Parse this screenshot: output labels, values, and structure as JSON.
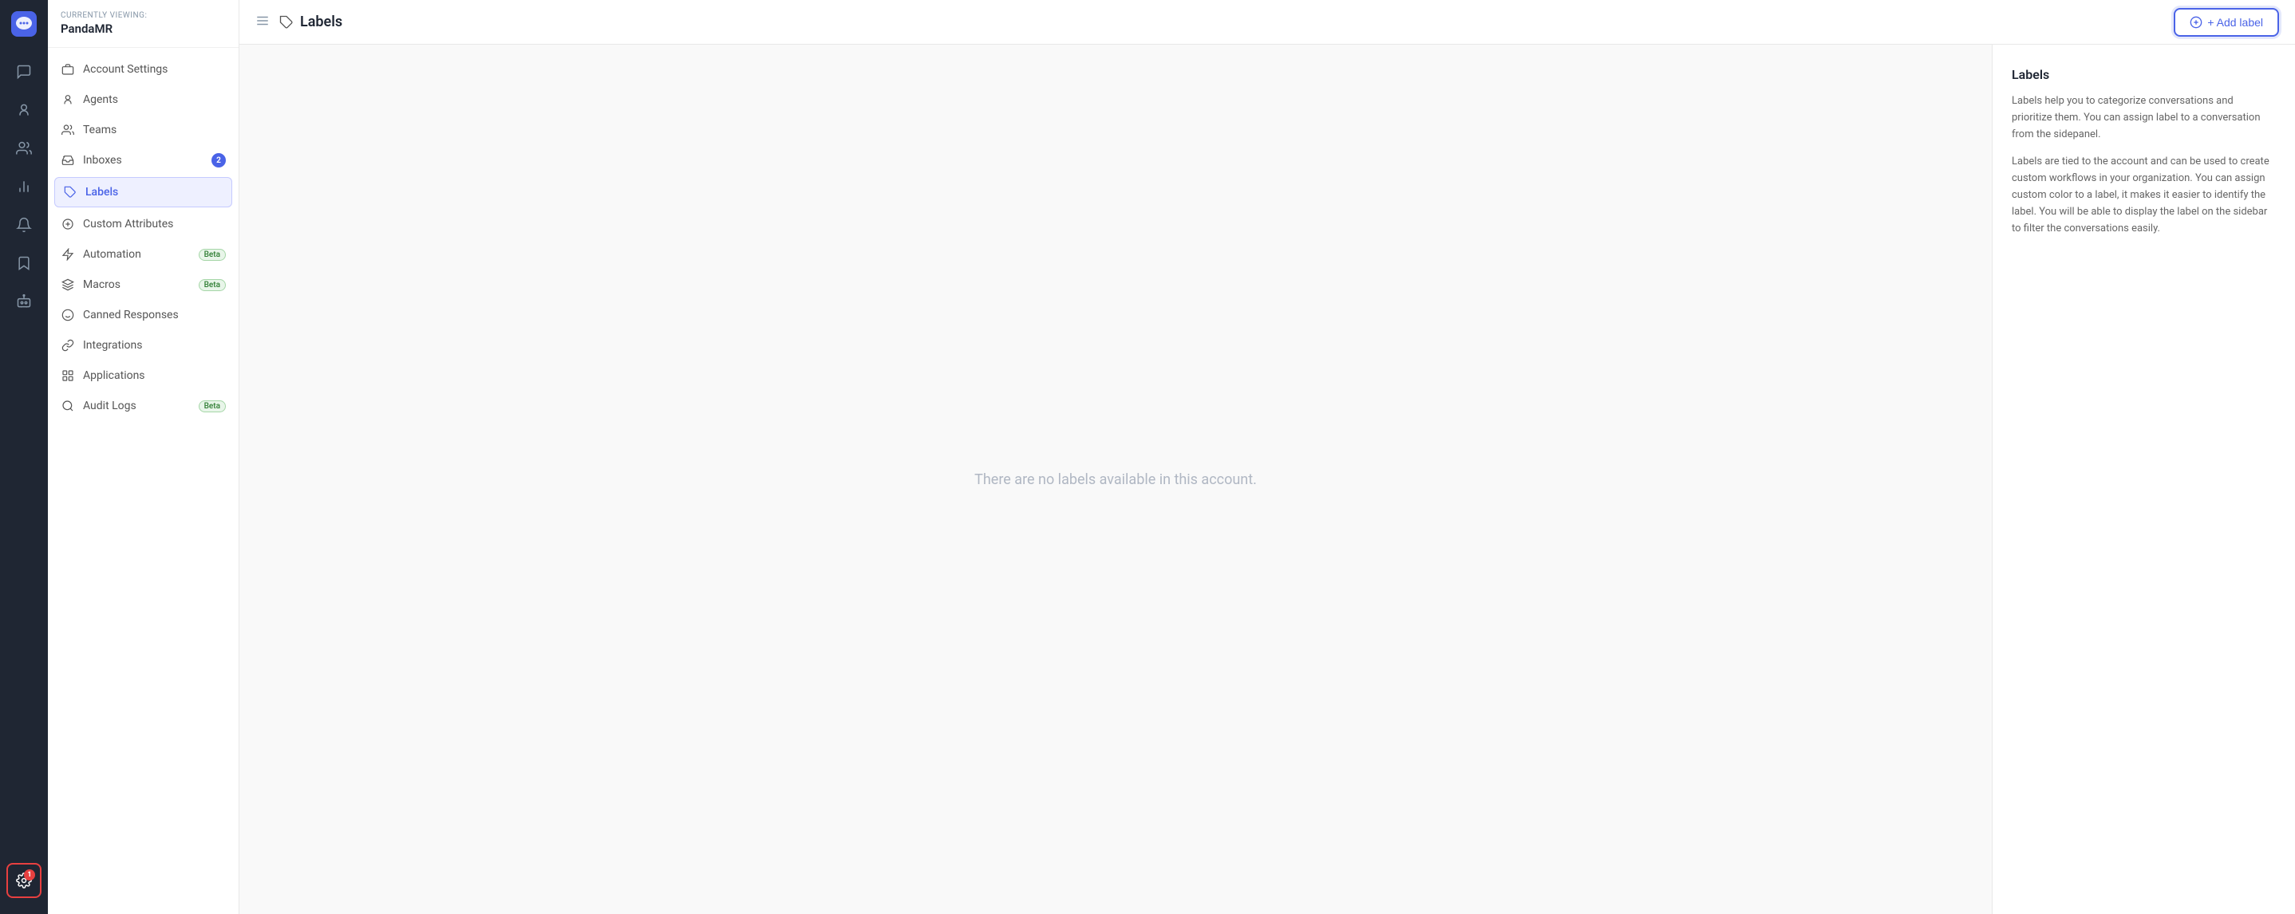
{
  "app": {
    "logo_alt": "Chatwoot logo"
  },
  "header": {
    "currently_viewing": "Currently viewing:",
    "account_name": "PandaMR",
    "page_icon": "label-icon",
    "page_title": "Labels",
    "add_button_label": "+ Add label"
  },
  "sidebar": {
    "items": [
      {
        "id": "account-settings",
        "label": "Account Settings",
        "icon": "briefcase-icon",
        "active": false,
        "badge": null,
        "beta": false
      },
      {
        "id": "agents",
        "label": "Agents",
        "icon": "users-icon",
        "active": false,
        "badge": null,
        "beta": false
      },
      {
        "id": "teams",
        "label": "Teams",
        "icon": "team-icon",
        "active": false,
        "badge": null,
        "beta": false
      },
      {
        "id": "inboxes",
        "label": "Inboxes",
        "icon": "inbox-icon",
        "active": false,
        "badge": "2",
        "beta": false
      },
      {
        "id": "labels",
        "label": "Labels",
        "icon": "label-icon",
        "active": true,
        "badge": null,
        "beta": false
      },
      {
        "id": "custom-attributes",
        "label": "Custom Attributes",
        "icon": "custom-attr-icon",
        "active": false,
        "badge": null,
        "beta": false
      },
      {
        "id": "automation",
        "label": "Automation",
        "icon": "automation-icon",
        "active": false,
        "badge": null,
        "beta": true
      },
      {
        "id": "macros",
        "label": "Macros",
        "icon": "macros-icon",
        "active": false,
        "badge": null,
        "beta": true
      },
      {
        "id": "canned-responses",
        "label": "Canned Responses",
        "icon": "canned-icon",
        "active": false,
        "badge": null,
        "beta": false
      },
      {
        "id": "integrations",
        "label": "Integrations",
        "icon": "integrations-icon",
        "active": false,
        "badge": null,
        "beta": false
      },
      {
        "id": "applications",
        "label": "Applications",
        "icon": "applications-icon",
        "active": false,
        "badge": null,
        "beta": false
      },
      {
        "id": "audit-logs",
        "label": "Audit Logs",
        "icon": "audit-icon",
        "active": false,
        "badge": null,
        "beta": true
      }
    ]
  },
  "icon_nav": {
    "items": [
      {
        "id": "conversations",
        "icon": "conversations-icon"
      },
      {
        "id": "contacts",
        "icon": "contacts-icon"
      },
      {
        "id": "people",
        "icon": "people-icon"
      },
      {
        "id": "reports",
        "icon": "reports-icon"
      },
      {
        "id": "notifications",
        "icon": "notifications-icon"
      },
      {
        "id": "saved",
        "icon": "saved-icon"
      },
      {
        "id": "bot",
        "icon": "bot-icon"
      }
    ],
    "bottom": [
      {
        "id": "settings",
        "icon": "settings-icon",
        "active": true
      }
    ]
  },
  "main": {
    "empty_state": "There are no labels available in this account."
  },
  "info_panel": {
    "title": "Labels",
    "paragraph1": "Labels help you to categorize conversations and prioritize them. You can assign label to a conversation from the sidepanel.",
    "paragraph2": "Labels are tied to the account and can be used to create custom workflows in your organization. You can assign custom color to a label, it makes it easier to identify the label. You will be able to display the label on the sidebar to filter the conversations easily."
  }
}
